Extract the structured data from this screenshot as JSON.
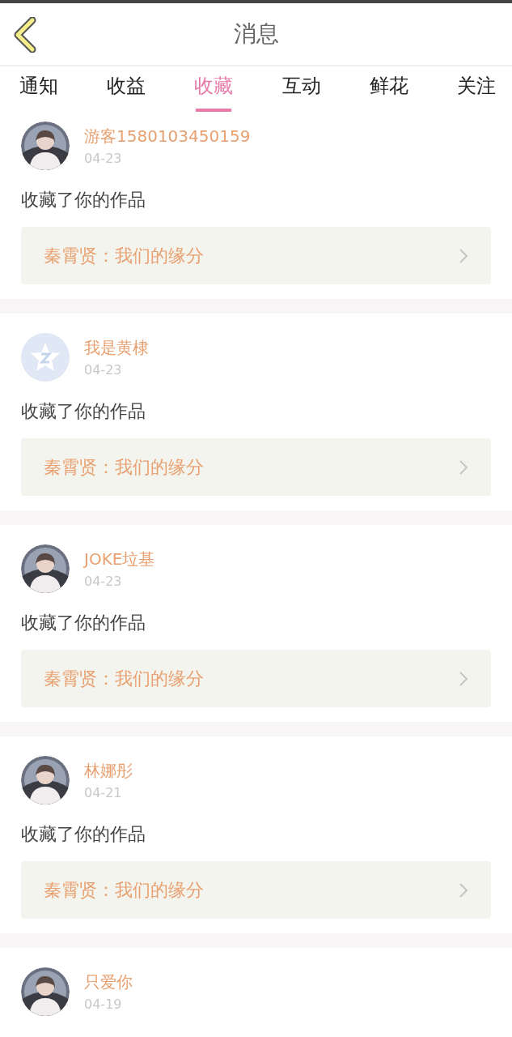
{
  "header": {
    "title": "消息"
  },
  "tabs": [
    {
      "label": "通知",
      "selected": false
    },
    {
      "label": "收益",
      "selected": false
    },
    {
      "label": "收藏",
      "selected": true
    },
    {
      "label": "互动",
      "selected": false
    },
    {
      "label": "鲜花",
      "selected": false
    },
    {
      "label": "关注",
      "selected": false
    }
  ],
  "messages": [
    {
      "user": "游客1580103450159",
      "date": "04-23",
      "action": "收藏了你的作品",
      "work": "秦霄贤：我们的缘分"
    },
    {
      "avatar": {
        "kind": "default"
      },
      "user": "我是黄棣",
      "date": "04-23",
      "action": "收藏了你的作品",
      "work": "秦霄贤：我们的缘分"
    },
    {
      "user": "JOKE垃基",
      "date": "04-23",
      "action": "收藏了你的作品",
      "work": "秦霄贤：我们的缘分"
    },
    {
      "user": "林娜彤",
      "date": "04-21",
      "action": "收藏了你的作品",
      "work": "秦霄贤：我们的缘分"
    },
    {
      "user": "只爱你",
      "date": "04-19"
    }
  ]
}
